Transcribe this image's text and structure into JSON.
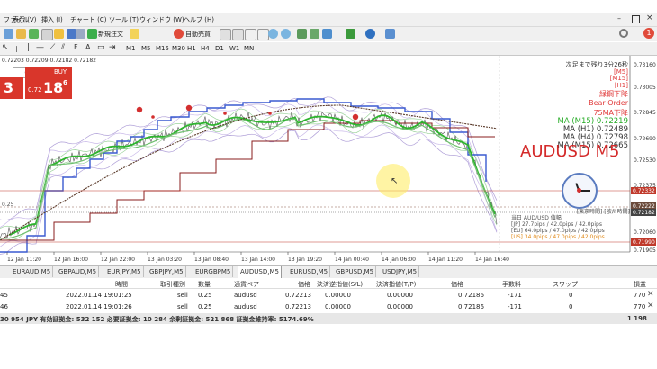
{
  "menubar": {
    "items": [
      "ファイル",
      "表示 (V)",
      "挿入 (I)",
      "チャート (C)",
      "ツール (T)",
      "ウィンドウ (W)",
      "ヘルプ (H)"
    ],
    "notification_count": "1"
  },
  "toolbar": {
    "new_order_label": "新規注文",
    "auto_trade_label": "自動売買"
  },
  "timeframes": [
    "M1",
    "M5",
    "M15",
    "M30",
    "H1",
    "H4",
    "D1",
    "W1",
    "MN"
  ],
  "chart": {
    "ohlc_header": "0.72203 0.72209 0.72182 0.72182",
    "oneclick": {
      "lot": "0.25",
      "buy_label": "BUY",
      "sell_digit": "3",
      "buy_small": "0.72",
      "buy_big": "18",
      "buy_sup": "6"
    },
    "info_lines": [
      {
        "text": "次足まで残り3分26秒",
        "color": "#333333"
      },
      {
        "text": "[M5]",
        "color": "#e03a3a"
      },
      {
        "text": "[M15]",
        "color": "#e03a3a"
      },
      {
        "text": "[H1]",
        "color": "#e03a3a"
      },
      {
        "text": "緑鋼下降",
        "color": "#e03a3a"
      },
      {
        "text": "Bear Order",
        "color": "#e03a3a"
      },
      {
        "text": "75MA下降",
        "color": "#e03a3a"
      },
      {
        "text": "MA (M15) 0.72219",
        "color": "#22aa22"
      },
      {
        "text": "MA (H1) 0.72489",
        "color": "#333333"
      },
      {
        "text": "MA (H4) 0.72798",
        "color": "#333333"
      },
      {
        "text": "MA (M15) 0.72665",
        "color": "#333333"
      }
    ],
    "symbol_big": "AUDUSD M5",
    "session_title": "[東京時間] [欧州時間]",
    "session_lines": [
      "当日 AUD/USD 値幅",
      "[JP] 27.7pips / 42.0pips / 42.0pips",
      "[EU] 64.0pips / 47.0pips / 42.0pips",
      "[US] 34.0pips / 47.0pips / 42.0pips"
    ],
    "left_tick": "0.25",
    "price_axis": [
      "0.73160",
      "0.73005",
      "0.72845",
      "0.72690",
      "0.72530",
      "0.72375",
      "0.72332",
      "0.72222",
      "0.72182",
      "0.72060",
      "0.71990",
      "0.71905"
    ],
    "price_tags": [
      {
        "text": "0.72332",
        "color": "#c0392b"
      },
      {
        "text": "0.72222",
        "color": "#6b4b3b"
      },
      {
        "text": "0.72182",
        "color": "#444444"
      },
      {
        "text": "0.71990",
        "color": "#c0392b"
      }
    ],
    "time_axis": [
      "12 Jan 11:20",
      "12 Jan 16:00",
      "12 Jan 22:00",
      "13 Jan 03:20",
      "13 Jan 08:40",
      "13 Jan 14:00",
      "13 Jan 19:20",
      "14 Jan 00:40",
      "14 Jan 06:00",
      "14 Jan 11:20",
      "14 Jan 16:40"
    ],
    "colors": {
      "ma_fast": "#2db52d",
      "ma_mid": "#3a5ad0",
      "ma_slow": "#5a3a2a",
      "step_line": "#8a1c1c",
      "price": "#555555",
      "bear": "#d32f2f"
    }
  },
  "tabs": [
    "EURAUD,M5",
    "GBPAUD,M5",
    "EURJPY,M5",
    "GBPJPY,M5",
    "EURGBPM5",
    "AUDUSD,M5",
    "EURUSD,M5",
    "GBPUSD,M5",
    "USDJPY,M5"
  ],
  "active_tab": "AUDUSD,M5",
  "terminal": {
    "columns": [
      "時間",
      "取引種別",
      "数量",
      "通貨ペア",
      "価格",
      "決済逆指値(S/L)",
      "決済指値(T/P)",
      "価格",
      "手数料",
      "スワップ",
      "損益"
    ],
    "rows": [
      {
        "id": "45",
        "time": "2022.01.14 19:01:25",
        "type": "sell",
        "size": "0.25",
        "symbol": "audusd",
        "price": "0.72213",
        "sl": "0.00000",
        "tp": "0.00000",
        "cur": "0.72186",
        "commission": "-171",
        "swap": "0",
        "profit": "770"
      },
      {
        "id": "46",
        "time": "2022.01.14 19:01:26",
        "type": "sell",
        "size": "0.25",
        "symbol": "audusd",
        "price": "0.72213",
        "sl": "0.00000",
        "tp": "0.00000",
        "cur": "0.72186",
        "commission": "-171",
        "swap": "0",
        "profit": "770"
      }
    ],
    "balance_line": "30 954 JPY  有効証拠金: 532 152  必要証拠金: 10 284  余剰証拠金: 521 868  証拠金維持率: 5174.69%",
    "total_profit": "1 198"
  }
}
